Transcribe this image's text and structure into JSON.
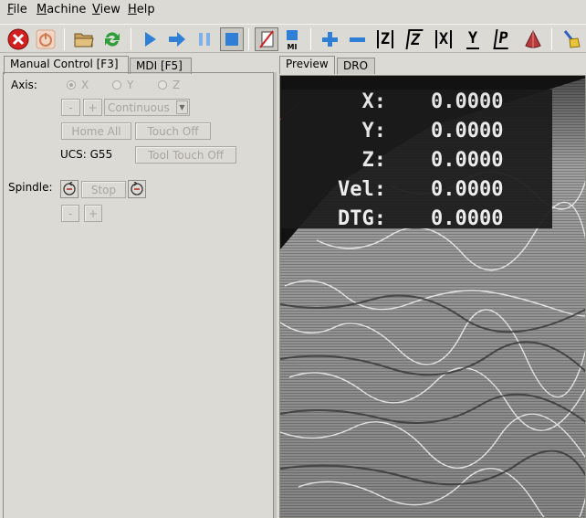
{
  "menu": [
    {
      "label_u": "F",
      "label_rest": "ile"
    },
    {
      "label_u": "M",
      "label_rest": "achine"
    },
    {
      "label_u": "V",
      "label_rest": "iew"
    },
    {
      "label_u": "H",
      "label_rest": "elp"
    }
  ],
  "toolbar": {
    "view_z": "Z",
    "view_z2": "Z",
    "view_x": "X",
    "view_y": "Y",
    "view_p": "P",
    "mi_label": "MI"
  },
  "left_tabs": {
    "manual": "Manual Control [F3]",
    "mdi": "MDI [F5]"
  },
  "manual": {
    "axis_label": "Axis:",
    "axis_x": "X",
    "axis_y": "Y",
    "axis_z": "Z",
    "jog_minus": "-",
    "jog_plus": "+",
    "jog_mode": "Continuous",
    "home_all": "Home All",
    "touch_off": "Touch Off",
    "ucs": "UCS: G55",
    "tool_touch_off": "Tool Touch Off",
    "spindle_label": "Spindle:",
    "spindle_stop": "Stop",
    "spindle_minus": "-",
    "spindle_plus": "+"
  },
  "right_tabs": {
    "preview": "Preview",
    "dro": "DRO"
  },
  "dro": [
    {
      "label": "X:",
      "value": "0.0000"
    },
    {
      "label": "Y:",
      "value": "0.0000"
    },
    {
      "label": "Z:",
      "value": "0.0000"
    },
    {
      "label": "Vel:",
      "value": "0.0000"
    },
    {
      "label": "DTG:",
      "value": "0.0000"
    }
  ],
  "colors": {
    "dro_bg": "#1b1b1b",
    "dro_text": "#f4f4f4",
    "estop_red": "#d21f1f",
    "run_blue": "#2f7fd6",
    "reload_green": "#2f9e3a"
  }
}
